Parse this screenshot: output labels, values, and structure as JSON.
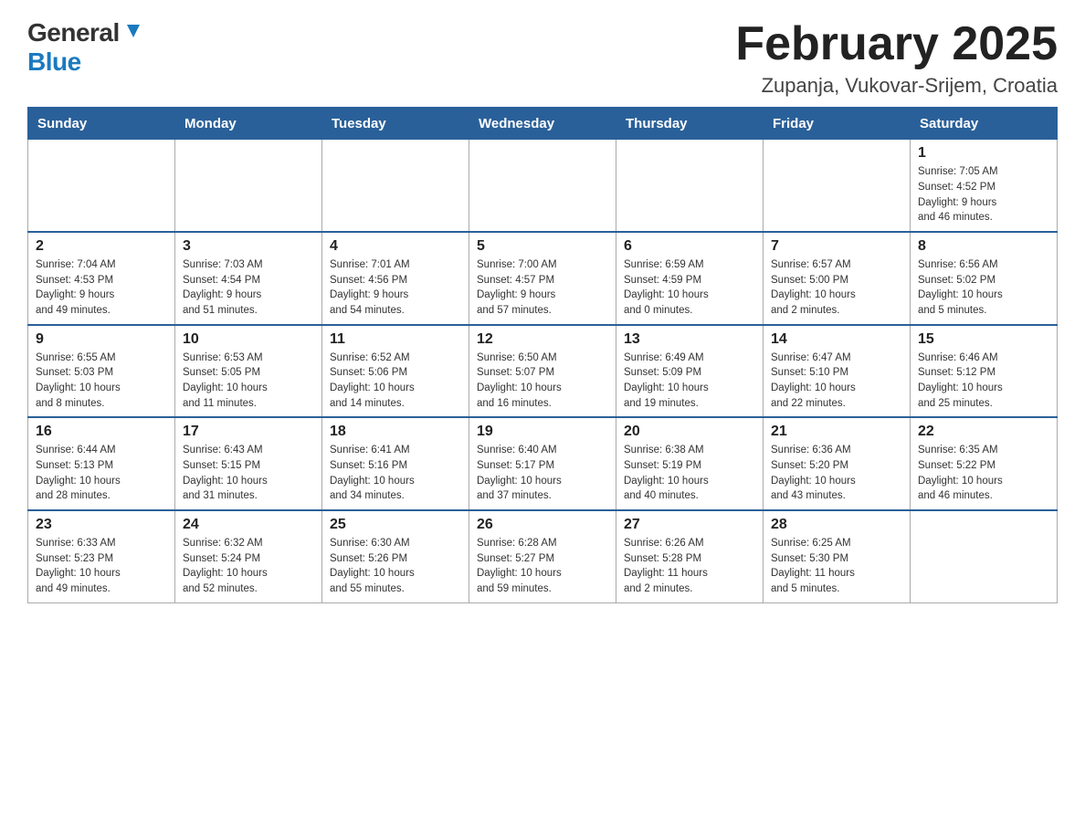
{
  "logo": {
    "general": "General",
    "blue": "Blue"
  },
  "title": "February 2025",
  "location": "Zupanja, Vukovar-Srijem, Croatia",
  "days_of_week": [
    "Sunday",
    "Monday",
    "Tuesday",
    "Wednesday",
    "Thursday",
    "Friday",
    "Saturday"
  ],
  "weeks": [
    [
      {
        "day": "",
        "info": ""
      },
      {
        "day": "",
        "info": ""
      },
      {
        "day": "",
        "info": ""
      },
      {
        "day": "",
        "info": ""
      },
      {
        "day": "",
        "info": ""
      },
      {
        "day": "",
        "info": ""
      },
      {
        "day": "1",
        "info": "Sunrise: 7:05 AM\nSunset: 4:52 PM\nDaylight: 9 hours\nand 46 minutes."
      }
    ],
    [
      {
        "day": "2",
        "info": "Sunrise: 7:04 AM\nSunset: 4:53 PM\nDaylight: 9 hours\nand 49 minutes."
      },
      {
        "day": "3",
        "info": "Sunrise: 7:03 AM\nSunset: 4:54 PM\nDaylight: 9 hours\nand 51 minutes."
      },
      {
        "day": "4",
        "info": "Sunrise: 7:01 AM\nSunset: 4:56 PM\nDaylight: 9 hours\nand 54 minutes."
      },
      {
        "day": "5",
        "info": "Sunrise: 7:00 AM\nSunset: 4:57 PM\nDaylight: 9 hours\nand 57 minutes."
      },
      {
        "day": "6",
        "info": "Sunrise: 6:59 AM\nSunset: 4:59 PM\nDaylight: 10 hours\nand 0 minutes."
      },
      {
        "day": "7",
        "info": "Sunrise: 6:57 AM\nSunset: 5:00 PM\nDaylight: 10 hours\nand 2 minutes."
      },
      {
        "day": "8",
        "info": "Sunrise: 6:56 AM\nSunset: 5:02 PM\nDaylight: 10 hours\nand 5 minutes."
      }
    ],
    [
      {
        "day": "9",
        "info": "Sunrise: 6:55 AM\nSunset: 5:03 PM\nDaylight: 10 hours\nand 8 minutes."
      },
      {
        "day": "10",
        "info": "Sunrise: 6:53 AM\nSunset: 5:05 PM\nDaylight: 10 hours\nand 11 minutes."
      },
      {
        "day": "11",
        "info": "Sunrise: 6:52 AM\nSunset: 5:06 PM\nDaylight: 10 hours\nand 14 minutes."
      },
      {
        "day": "12",
        "info": "Sunrise: 6:50 AM\nSunset: 5:07 PM\nDaylight: 10 hours\nand 16 minutes."
      },
      {
        "day": "13",
        "info": "Sunrise: 6:49 AM\nSunset: 5:09 PM\nDaylight: 10 hours\nand 19 minutes."
      },
      {
        "day": "14",
        "info": "Sunrise: 6:47 AM\nSunset: 5:10 PM\nDaylight: 10 hours\nand 22 minutes."
      },
      {
        "day": "15",
        "info": "Sunrise: 6:46 AM\nSunset: 5:12 PM\nDaylight: 10 hours\nand 25 minutes."
      }
    ],
    [
      {
        "day": "16",
        "info": "Sunrise: 6:44 AM\nSunset: 5:13 PM\nDaylight: 10 hours\nand 28 minutes."
      },
      {
        "day": "17",
        "info": "Sunrise: 6:43 AM\nSunset: 5:15 PM\nDaylight: 10 hours\nand 31 minutes."
      },
      {
        "day": "18",
        "info": "Sunrise: 6:41 AM\nSunset: 5:16 PM\nDaylight: 10 hours\nand 34 minutes."
      },
      {
        "day": "19",
        "info": "Sunrise: 6:40 AM\nSunset: 5:17 PM\nDaylight: 10 hours\nand 37 minutes."
      },
      {
        "day": "20",
        "info": "Sunrise: 6:38 AM\nSunset: 5:19 PM\nDaylight: 10 hours\nand 40 minutes."
      },
      {
        "day": "21",
        "info": "Sunrise: 6:36 AM\nSunset: 5:20 PM\nDaylight: 10 hours\nand 43 minutes."
      },
      {
        "day": "22",
        "info": "Sunrise: 6:35 AM\nSunset: 5:22 PM\nDaylight: 10 hours\nand 46 minutes."
      }
    ],
    [
      {
        "day": "23",
        "info": "Sunrise: 6:33 AM\nSunset: 5:23 PM\nDaylight: 10 hours\nand 49 minutes."
      },
      {
        "day": "24",
        "info": "Sunrise: 6:32 AM\nSunset: 5:24 PM\nDaylight: 10 hours\nand 52 minutes."
      },
      {
        "day": "25",
        "info": "Sunrise: 6:30 AM\nSunset: 5:26 PM\nDaylight: 10 hours\nand 55 minutes."
      },
      {
        "day": "26",
        "info": "Sunrise: 6:28 AM\nSunset: 5:27 PM\nDaylight: 10 hours\nand 59 minutes."
      },
      {
        "day": "27",
        "info": "Sunrise: 6:26 AM\nSunset: 5:28 PM\nDaylight: 11 hours\nand 2 minutes."
      },
      {
        "day": "28",
        "info": "Sunrise: 6:25 AM\nSunset: 5:30 PM\nDaylight: 11 hours\nand 5 minutes."
      },
      {
        "day": "",
        "info": ""
      }
    ]
  ]
}
